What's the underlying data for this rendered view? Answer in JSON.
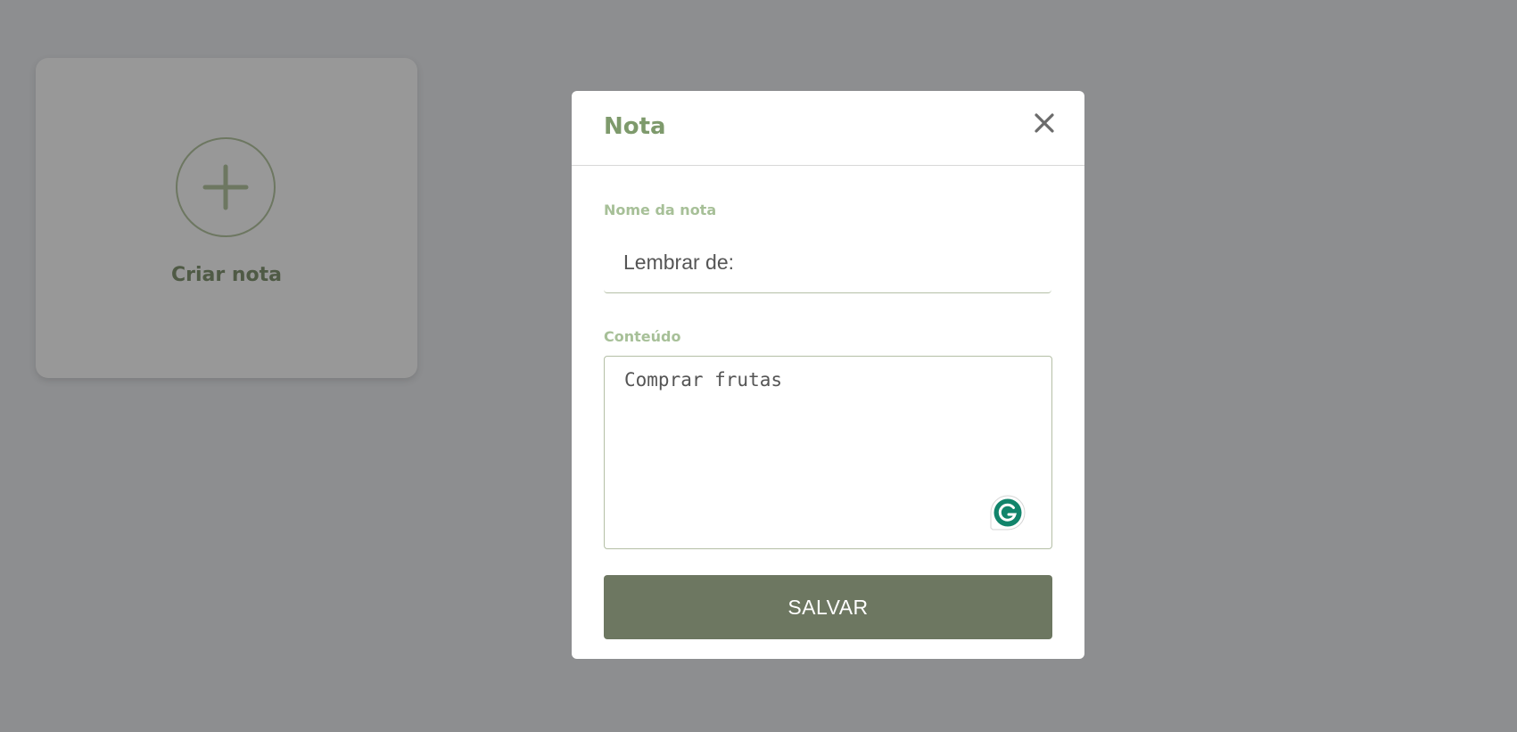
{
  "page": {
    "background_color": "#8d8e90"
  },
  "create_card": {
    "label": "Criar nota",
    "icon": "plus-circle-icon"
  },
  "modal": {
    "title": "Nota",
    "close_icon": "close-icon",
    "name_field": {
      "label": "Nome da nota",
      "value": "Lembrar de:"
    },
    "content_field": {
      "label": "Conteúdo",
      "value": "Comprar frutas"
    },
    "grammarly_icon": "grammarly-icon",
    "save_label": "SALVAR"
  },
  "colors": {
    "accent_green": "#6d7761",
    "title_green": "#7e9a6c",
    "label_green": "#a7c098"
  }
}
